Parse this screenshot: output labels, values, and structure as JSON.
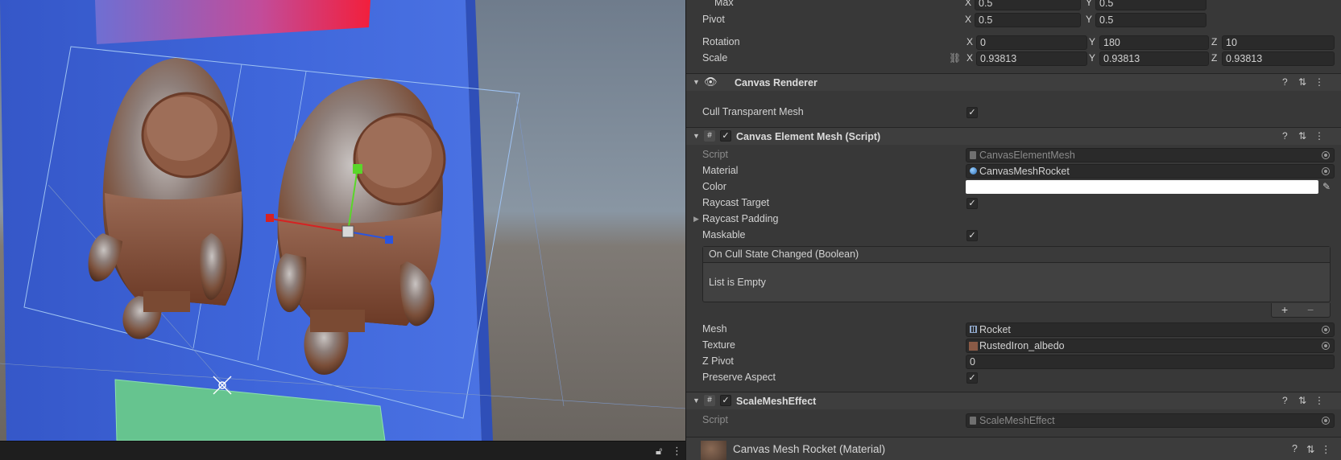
{
  "scene": {
    "icons": [
      "lock-icon",
      "more-vertical-icon"
    ]
  },
  "inspector": {
    "rect_transform": {
      "max": {
        "label": "Max",
        "x_axis": "X",
        "x": "0.5",
        "y_axis": "Y",
        "y": "0.5"
      },
      "pivot": {
        "label": "Pivot",
        "x_axis": "X",
        "x": "0.5",
        "y_axis": "Y",
        "y": "0.5"
      },
      "rotation": {
        "label": "Rotation",
        "x_axis": "X",
        "x": "0",
        "y_axis": "Y",
        "y": "180",
        "z_axis": "Z",
        "z": "10"
      },
      "scale": {
        "label": "Scale",
        "x_axis": "X",
        "x": "0.93813",
        "y_axis": "Y",
        "y": "0.93813",
        "z_axis": "Z",
        "z": "0.93813"
      }
    },
    "canvas_renderer": {
      "title": "Canvas Renderer",
      "cull_label": "Cull Transparent Mesh",
      "cull_checked": "✓"
    },
    "canvas_element_mesh": {
      "title": "Canvas Element Mesh (Script)",
      "enabled": "✓",
      "script_label": "Script",
      "script_value": "CanvasElementMesh",
      "material_label": "Material",
      "material_value": "CanvasMeshRocket",
      "color_label": "Color",
      "color_value": "#ffffff",
      "raycast_target_label": "Raycast Target",
      "raycast_target_checked": "✓",
      "raycast_padding_label": "Raycast Padding",
      "maskable_label": "Maskable",
      "maskable_checked": "✓",
      "event_title": "On Cull State Changed (Boolean)",
      "event_empty": "List is Empty",
      "event_add": "+",
      "event_remove": "−",
      "mesh_label": "Mesh",
      "mesh_value": "Rocket",
      "texture_label": "Texture",
      "texture_value": "RustedIron_albedo",
      "zpivot_label": "Z Pivot",
      "zpivot_value": "0",
      "preserve_label": "Preserve Aspect",
      "preserve_checked": "✓"
    },
    "scale_mesh_effect": {
      "title": "ScaleMeshEffect",
      "enabled": "✓",
      "script_label": "Script",
      "script_value": "ScaleMeshEffect"
    },
    "material_header": {
      "title": "Canvas Mesh Rocket (Material)"
    },
    "header_buttons": {
      "help": "?",
      "preset": "⇅",
      "menu": "⋮"
    }
  },
  "colors": {
    "inspector_bg": "#383838",
    "header_bg": "#3e3e3e",
    "field_bg": "#2a2a2a",
    "highlight_underline": "#ff5a1a",
    "canvas_blue": "#3d62d6",
    "panel_green": "#66c48f"
  }
}
